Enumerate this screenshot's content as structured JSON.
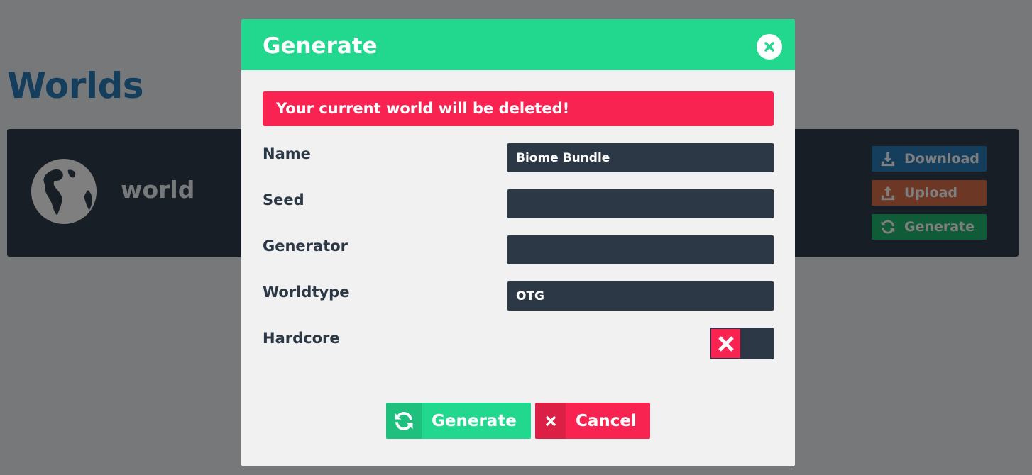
{
  "page": {
    "title": "Worlds"
  },
  "world_card": {
    "name": "world",
    "icon": "globe-icon",
    "buttons": {
      "download": "Download",
      "upload": "Upload",
      "generate": "Generate"
    }
  },
  "modal": {
    "title": "Generate",
    "close_icon": "close-icon",
    "alert": "Your current world will be deleted!",
    "fields": {
      "name": {
        "label": "Name",
        "value": "Biome Bundle"
      },
      "seed": {
        "label": "Seed",
        "value": ""
      },
      "generator": {
        "label": "Generator",
        "value": ""
      },
      "worldtype": {
        "label": "Worldtype",
        "value": "OTG"
      },
      "hardcore": {
        "label": "Hardcore",
        "enabled": false
      }
    },
    "footer": {
      "generate_label": "Generate",
      "cancel_label": "Cancel"
    }
  },
  "colors": {
    "accent_green": "#22d88e",
    "danger_red": "#f82350",
    "input_dark": "#2c3846",
    "title_blue": "#2a7ab9",
    "upload_orange": "#d9714a"
  }
}
